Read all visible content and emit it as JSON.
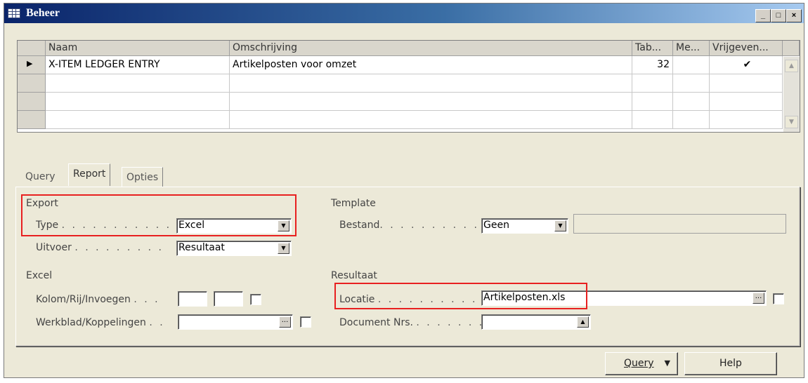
{
  "window": {
    "title": "Beheer"
  },
  "title_buttons": {
    "minimize": "_",
    "maximize": "□",
    "close": "×"
  },
  "grid": {
    "columns": [
      "Naam",
      "Omschrijving",
      "Tab...",
      "Me...",
      "Vrijgeven..."
    ],
    "rows": [
      {
        "naam": "X-ITEM LEDGER ENTRY",
        "omschrijving": "Artikelposten voor omzet",
        "tab": "32",
        "me": "",
        "vrijgeven": "✔"
      }
    ]
  },
  "tabs": [
    "Query",
    "Report",
    "Opties"
  ],
  "active_tab": "Report",
  "export": {
    "heading": "Export",
    "type_label": "Type",
    "type_value": "Excel",
    "uitvoer_label": "Uitvoer",
    "uitvoer_value": "Resultaat"
  },
  "excel": {
    "heading": "Excel",
    "kolom_label": "Kolom/Rij/Invoegen",
    "kolom_value": "",
    "rij_value": "",
    "werkblad_label": "Werkblad/Koppelingen",
    "werkblad_value": ""
  },
  "template": {
    "heading": "Template",
    "bestand_label": "Bestand",
    "bestand_value": "Geen",
    "bestand_path": ""
  },
  "resultaat": {
    "heading": "Resultaat",
    "locatie_label": "Locatie",
    "locatie_value": "Artikelposten.xls",
    "document_label": "Document Nrs.",
    "document_value": ""
  },
  "buttons": {
    "query": "Query",
    "help": "Help"
  },
  "icons": {
    "dropdown": "▼",
    "ellipsis": "...",
    "up": "▲",
    "row_pointer": "▶"
  },
  "colors": {
    "highlight": "#e82020",
    "titlebar": "#0a246a"
  }
}
